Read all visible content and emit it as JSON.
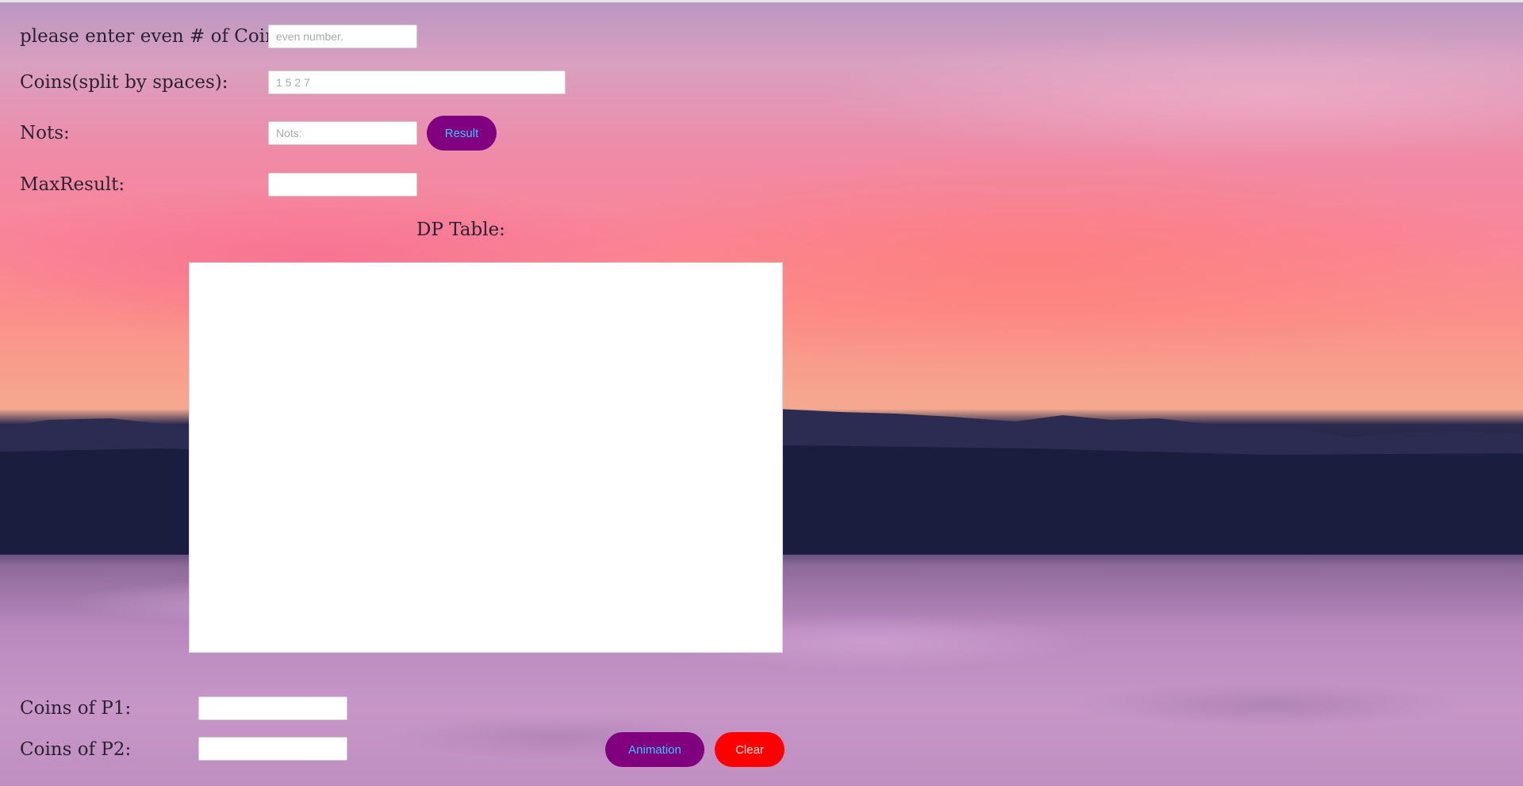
{
  "form": {
    "coins_count": {
      "label": "please enter even # of Coins:",
      "value": "",
      "placeholder": "even number."
    },
    "coins_list": {
      "label": "Coins(split by spaces):",
      "value": "",
      "placeholder": "1 5 2 7"
    },
    "nots": {
      "label": "Nots:",
      "value": "",
      "placeholder": "Nots:"
    },
    "result_button": "Result",
    "max_result": {
      "label": "MaxResult:",
      "value": ""
    }
  },
  "dp_table": {
    "title": "DP Table:"
  },
  "players": {
    "p1": {
      "label": "Coins of P1:",
      "value": ""
    },
    "p2": {
      "label": "Coins of P2:",
      "value": ""
    }
  },
  "controls": {
    "animation_button": "Animation",
    "clear_button": "Clear"
  },
  "colors": {
    "button_primary": "#800080",
    "button_primary_text": "#33c9ff",
    "button_danger": "#ff0000"
  }
}
